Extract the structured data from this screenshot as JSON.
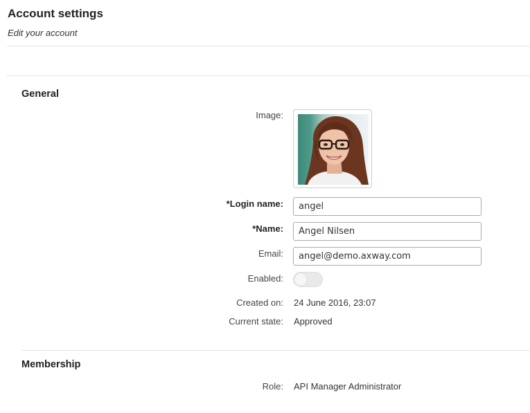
{
  "header": {
    "title": "Account settings",
    "subtitle": "Edit your account"
  },
  "general": {
    "section_title": "General",
    "image_label": "Image:",
    "avatar_alt": "Profile photo",
    "login_name": {
      "label": "*Login name:",
      "value": "angel"
    },
    "name": {
      "label": "*Name:",
      "value": "Angel Nilsen"
    },
    "email": {
      "label": "Email:",
      "value": "angel@demo.axway.com"
    },
    "enabled": {
      "label": "Enabled:",
      "state": "off (disabled)"
    },
    "created_on": {
      "label": "Created on:",
      "value": "24 June 2016, 23:07"
    },
    "current_state": {
      "label": "Current state:",
      "value": "Approved"
    }
  },
  "membership": {
    "section_title": "Membership",
    "role": {
      "label": "Role:",
      "value": "API Manager Administrator"
    }
  },
  "colors": {
    "text": "#333333",
    "heading": "#222222",
    "rule": "#e4e4e4",
    "input_border": "#a9a9a9"
  }
}
